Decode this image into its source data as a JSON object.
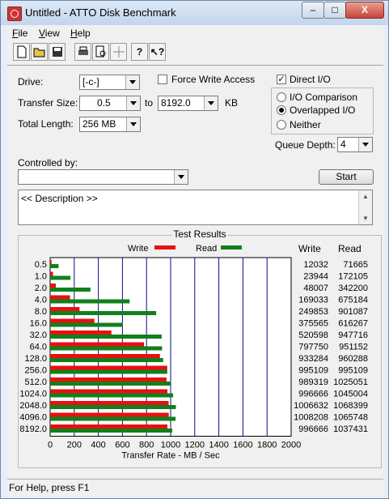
{
  "window": {
    "title": "Untitled - ATTO Disk Benchmark",
    "controls": {
      "minimize": "–",
      "maximize": "□",
      "close": "X"
    }
  },
  "menu": [
    {
      "label": "File"
    },
    {
      "label": "View"
    },
    {
      "label": "Help"
    }
  ],
  "toolbar": [
    {
      "name": "new-icon"
    },
    {
      "name": "open-folder-icon"
    },
    {
      "name": "save-icon"
    },
    {
      "name": "print-icon"
    },
    {
      "name": "print-preview-icon"
    },
    {
      "name": "move-icon"
    },
    {
      "name": "help-icon"
    },
    {
      "name": "context-help-icon"
    }
  ],
  "settings": {
    "drive_label": "Drive:",
    "drive_value": "[-c-]",
    "force_write_label": "Force Write Access",
    "force_write_checked": false,
    "direct_io_label": "Direct I/O",
    "direct_io_checked": true,
    "transfer_size_label": "Transfer Size:",
    "transfer_from": "0.5",
    "to_label": "to",
    "transfer_to": "8192.0",
    "unit_label": "KB",
    "total_length_label": "Total Length:",
    "total_length_value": "256 MB",
    "io_comparison_label": "I/O Comparison",
    "overlapped_io_label": "Overlapped I/O",
    "neither_label": "Neither",
    "selected_io_mode": "Overlapped I/O",
    "queue_depth_label": "Queue Depth:",
    "queue_depth_value": "4",
    "controlled_by_label": "Controlled by:",
    "controlled_by_value": "",
    "start_label": "Start",
    "description_text": "<< Description >>"
  },
  "results": {
    "title": "Test Results",
    "write_header": "Write",
    "read_header": "Read"
  },
  "chart_data": {
    "type": "bar",
    "orientation": "horizontal",
    "categories": [
      "0.5",
      "1.0",
      "2.0",
      "4.0",
      "8.0",
      "16.0",
      "32.0",
      "64.0",
      "128.0",
      "256.0",
      "512.0",
      "1024.0",
      "2048.0",
      "4096.0",
      "8192.0"
    ],
    "series": [
      {
        "name": "Write",
        "color": "#e81010",
        "values": [
          11.75,
          23.38,
          46.88,
          165.07,
          244.0,
          366.8,
          508.4,
          779.1,
          911.4,
          971.8,
          966.1,
          973.3,
          983.0,
          984.6,
          973.3
        ],
        "raw_values": [
          12032,
          23944,
          48007,
          169033,
          249853,
          375565,
          520598,
          797750,
          933284,
          995109,
          989319,
          996666,
          1006632,
          1008208,
          996666
        ]
      },
      {
        "name": "Read",
        "color": "#10801a",
        "values": [
          69.99,
          168.08,
          334.18,
          659.45,
          879.97,
          601.82,
          925.5,
          928.9,
          937.8,
          971.8,
          1001.0,
          1020.6,
          1043.4,
          1040.8,
          1013.1
        ],
        "raw_values": [
          71665,
          172105,
          342200,
          675184,
          901087,
          616267,
          947716,
          951152,
          960288,
          995109,
          1025051,
          1045004,
          1068399,
          1065748,
          1037431
        ]
      }
    ],
    "xlabel": "Transfer Rate - MB / Sec",
    "xlim": [
      0,
      2000
    ],
    "xticks": [
      "0",
      "200",
      "400",
      "600",
      "800",
      "1000",
      "1200",
      "1400",
      "1600",
      "1800",
      "2000"
    ],
    "grid": true,
    "legend": "top"
  },
  "status": {
    "text": "For Help, press F1"
  },
  "colors": {
    "write": "#e81010",
    "read": "#10801a",
    "gridline": "#0a0a8a"
  }
}
